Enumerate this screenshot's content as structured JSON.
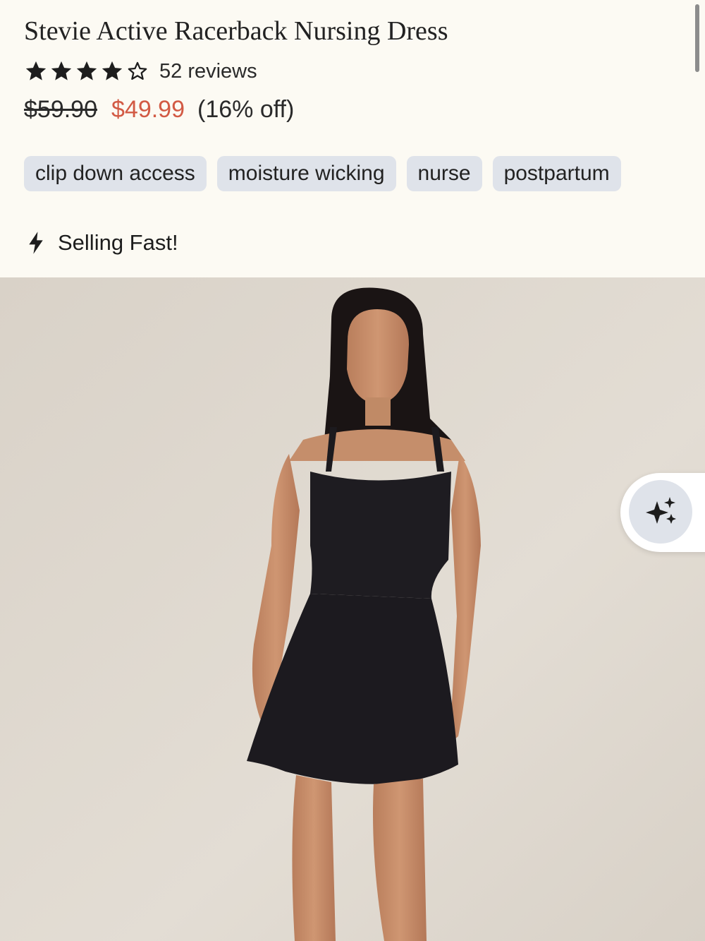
{
  "product": {
    "title": "Stevie Active Racerback Nursing Dress",
    "rating": 4,
    "rating_max": 5,
    "review_count": "52 reviews",
    "price_original": "$59.90",
    "price_sale": "$49.99",
    "discount": "(16% off)",
    "sale_color": "#d25a44"
  },
  "tags": [
    "clip down access",
    "moisture wicking",
    "nurse",
    "postpartum"
  ],
  "status": {
    "icon": "lightning-bolt-icon",
    "label": "Selling Fast!"
  },
  "ai_button": {
    "icon": "sparkles-icon"
  },
  "colors": {
    "background": "#fcfaf3",
    "tag_bg": "#dfe3ea",
    "photo_bg": "#ddd6cd"
  }
}
